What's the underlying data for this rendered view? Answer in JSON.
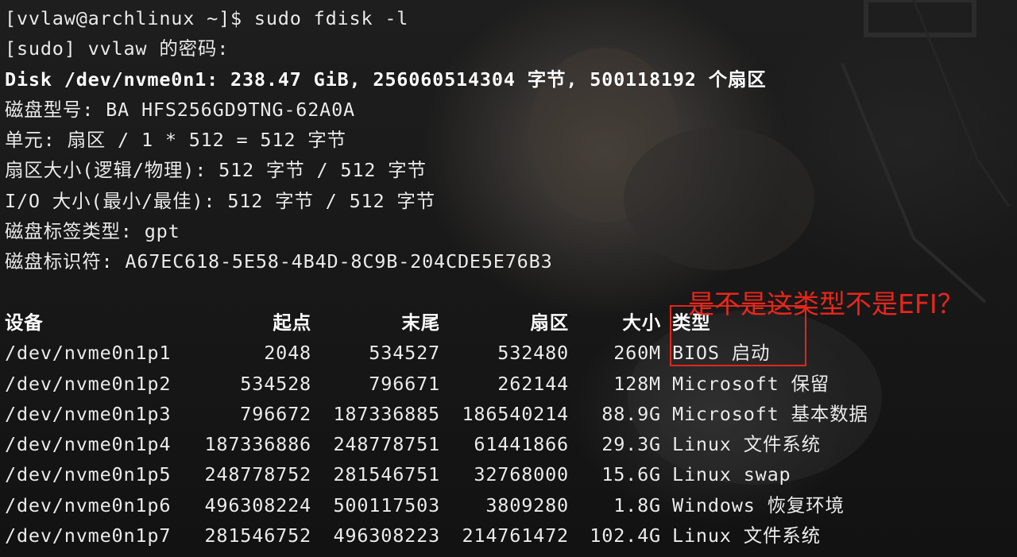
{
  "terminal": {
    "lines": [
      "[vvlaw@archlinux ~]$ sudo fdisk -l",
      "[sudo] vvlaw 的密码:",
      "Disk /dev/nvme0n1: 238.47 GiB, 256060514304 字节, 500118192 个扇区",
      "磁盘型号: BA HFS256GD9TNG-62A0A",
      "单元: 扇区 / 1 * 512 = 512 字节",
      "扇区大小(逻辑/物理): 512 字节 / 512 字节",
      "I/O 大小(最小/最佳): 512 字节 / 512 字节",
      "磁盘标签类型: gpt",
      "磁盘标识符: A67EC618-5E58-4B4D-8C9B-204CDE5E76B3"
    ]
  },
  "table": {
    "headers": {
      "device": "设备",
      "start": "起点",
      "end": "末尾",
      "sectors": "扇区",
      "size": "大小",
      "type": "类型"
    },
    "rows": [
      {
        "device": "/dev/nvme0n1p1",
        "start": "2048",
        "end": "534527",
        "sectors": "532480",
        "size": "260M",
        "type": "BIOS 启动"
      },
      {
        "device": "/dev/nvme0n1p2",
        "start": "534528",
        "end": "796671",
        "sectors": "262144",
        "size": "128M",
        "type": "Microsoft 保留"
      },
      {
        "device": "/dev/nvme0n1p3",
        "start": "796672",
        "end": "187336885",
        "sectors": "186540214",
        "size": "88.9G",
        "type": "Microsoft 基本数据"
      },
      {
        "device": "/dev/nvme0n1p4",
        "start": "187336886",
        "end": "248778751",
        "sectors": "61441866",
        "size": "29.3G",
        "type": "Linux 文件系统"
      },
      {
        "device": "/dev/nvme0n1p5",
        "start": "248778752",
        "end": "281546751",
        "sectors": "32768000",
        "size": "15.6G",
        "type": "Linux swap"
      },
      {
        "device": "/dev/nvme0n1p6",
        "start": "496308224",
        "end": "500117503",
        "sectors": "3809280",
        "size": "1.8G",
        "type": "Windows 恢复环境"
      },
      {
        "device": "/dev/nvme0n1p7",
        "start": "281546752",
        "end": "496308223",
        "sectors": "214761472",
        "size": "102.4G",
        "type": "Linux 文件系统"
      }
    ]
  },
  "annotation": {
    "text": "是不是这类型不是EFI？",
    "color": "#e8261b"
  }
}
